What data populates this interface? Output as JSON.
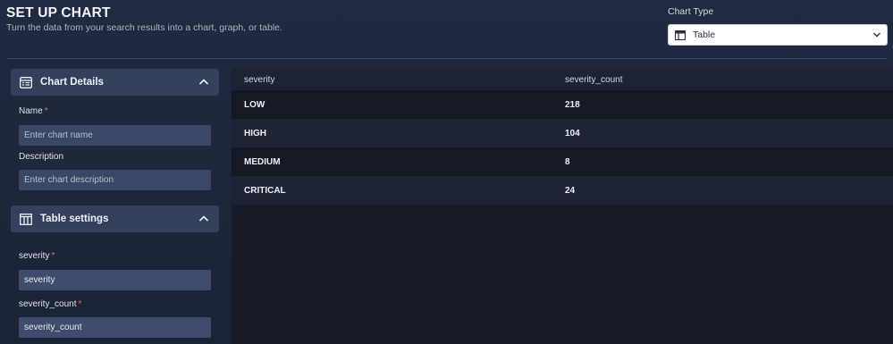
{
  "header": {
    "title": "SET UP CHART",
    "subtitle": "Turn the data from your search results into a chart, graph, or table.",
    "chart_type_label": "Chart Type",
    "chart_type_value": "Table"
  },
  "chart_details": {
    "title": "Chart Details",
    "name_label": "Name",
    "name_placeholder": "Enter chart name",
    "description_label": "Description",
    "description_placeholder": "Enter chart description"
  },
  "table_settings": {
    "title": "Table settings",
    "fields": [
      {
        "label": "severity",
        "value": "severity"
      },
      {
        "label": "severity_count",
        "value": "severity_count"
      }
    ]
  },
  "table": {
    "columns": [
      "severity",
      "severity_count"
    ],
    "rows": [
      [
        "LOW",
        "218"
      ],
      [
        "HIGH",
        "104"
      ],
      [
        "MEDIUM",
        "8"
      ],
      [
        "CRITICAL",
        "24"
      ]
    ]
  },
  "colors": {
    "background": "#1f283d",
    "panel_header": "#34405c",
    "input_bg": "#3a4766",
    "required": "#e06a6a"
  },
  "icons": [
    "table-icon",
    "chevron-down-icon",
    "chart-details-icon",
    "chevron-up-icon",
    "columns-icon"
  ]
}
